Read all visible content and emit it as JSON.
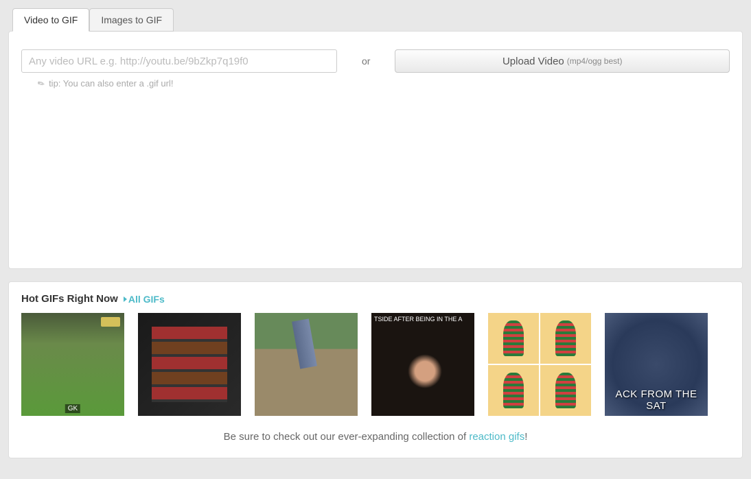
{
  "tabs": [
    {
      "label": "Video to GIF",
      "active": true
    },
    {
      "label": "Images to GIF",
      "active": false
    }
  ],
  "input": {
    "url_placeholder": "Any video URL e.g. http://youtu.be/9bZkp7q19f0",
    "or_label": "or",
    "upload_label": "Upload Video",
    "upload_sub": "(mp4/ogg best)",
    "tip_text": "tip: You can also enter a .gif url!"
  },
  "hot": {
    "title": "Hot GIFs Right Now",
    "all_link": "All GIFs",
    "thumbs": [
      {
        "name": "soccer-goalkeeper"
      },
      {
        "name": "vending-machine-cans"
      },
      {
        "name": "stepping-on-treadmill"
      },
      {
        "name": "man-laughing-hat"
      },
      {
        "name": "striped-shirt-grid"
      },
      {
        "name": "back-from-the-sat"
      }
    ]
  },
  "footer": {
    "prefix": "Be sure to check out our ever-expanding collection of ",
    "link": "reaction gifs",
    "suffix": "!"
  }
}
